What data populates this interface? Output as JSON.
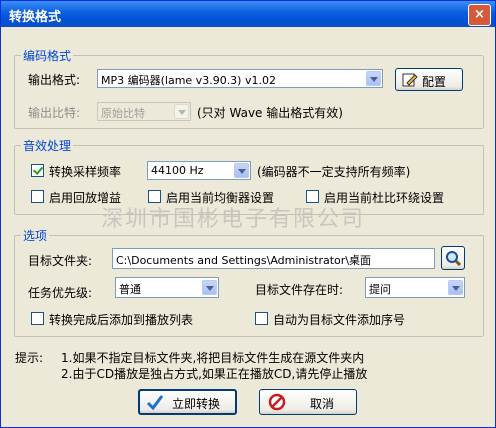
{
  "window": {
    "title": "转换格式",
    "close_label": "×"
  },
  "encode": {
    "legend": "编码格式",
    "format_label": "输出格式:",
    "format_value": "MP3 编码器(lame v3.90.3) v1.02",
    "config_button": "配置",
    "bitrate_label": "输出比特:",
    "bitrate_value": "原始比特",
    "bitrate_note": "(只对 Wave 输出格式有效)"
  },
  "sound": {
    "legend": "音效处理",
    "resample_label": "转换采样频率",
    "resample_checked": true,
    "resample_value": "44100 Hz",
    "resample_note": "(编码器不一定支持所有频率)",
    "replay_gain_label": "启用回放增益",
    "replay_gain_checked": false,
    "equalizer_label": "启用当前均衡器设置",
    "equalizer_checked": false,
    "dolby_label": "启用当前杜比环绕设置",
    "dolby_checked": false
  },
  "options": {
    "legend": "选项",
    "target_folder_label": "目标文件夹:",
    "target_folder_value": "C:\\Documents and Settings\\Administrator\\桌面",
    "priority_label": "任务优先级:",
    "priority_value": "普通",
    "exists_label": "目标文件存在时:",
    "exists_value": "提问",
    "add_playlist_label": "转换完成后添加到播放列表",
    "add_playlist_checked": false,
    "add_number_label": "自动为目标文件添加序号",
    "add_number_checked": false
  },
  "watermark": "深圳市国彬电子有限公司",
  "tips": {
    "label": "提示:",
    "line1": "1.如果不指定目标文件夹,将把目标文件生成在源文件夹内",
    "line2": "2.由于CD播放是独占方式,如果正在播放CD,请先停止播放"
  },
  "buttons": {
    "convert": "立即转换",
    "cancel": "取消"
  },
  "colors": {
    "title_bar": "#0a5ee0",
    "legend": "#0046d5",
    "face": "#ece9d8"
  }
}
